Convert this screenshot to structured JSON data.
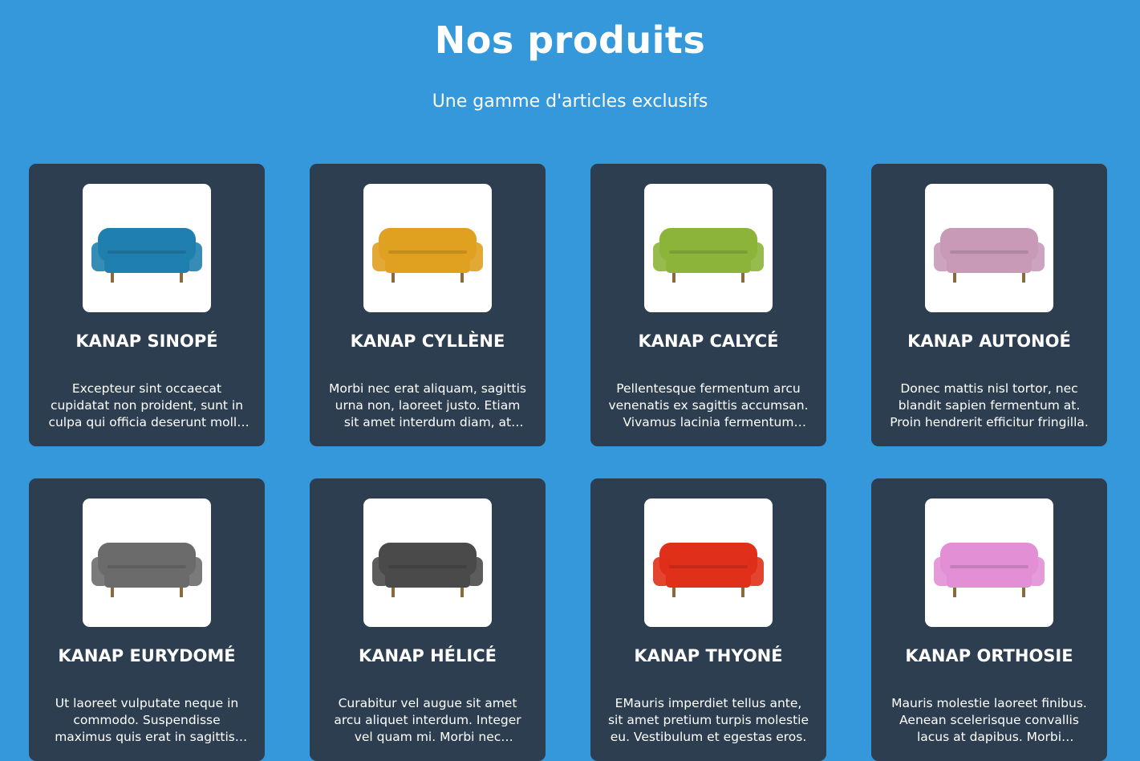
{
  "header": {
    "title": "Nos produits",
    "subtitle": "Une gamme d'articles exclusifs"
  },
  "products": [
    {
      "name": "Kanap Sinopé",
      "description": "Excepteur sint occaecat cupidatat non proident, sunt in culpa qui officia deserunt mollit anim id est laborum.",
      "color": "#1f7fae",
      "icon": "sofa-image"
    },
    {
      "name": "Kanap Cyllène",
      "description": "Morbi nec erat aliquam, sagittis urna non, laoreet justo. Etiam sit amet interdum diam, at accumsan lectus.",
      "color": "#e0a020",
      "icon": "sofa-image"
    },
    {
      "name": "Kanap Calycé",
      "description": "Pellentesque fermentum arcu venenatis ex sagittis accumsan. Vivamus lacinia fermentum tortor.",
      "color": "#8cb43a",
      "icon": "sofa-image"
    },
    {
      "name": "Kanap Autonoé",
      "description": "Donec mattis nisl tortor, nec blandit sapien fermentum at. Proin hendrerit efficitur fringilla.",
      "color": "#c89ab8",
      "icon": "sofa-image"
    },
    {
      "name": "Kanap Eurydomé",
      "description": "Ut laoreet vulputate neque in commodo. Suspendisse maximus quis erat in sagittis. Donec hendrerit purus.",
      "color": "#6b6b6b",
      "icon": "sofa-image"
    },
    {
      "name": "Kanap Hélicé",
      "description": "Curabitur vel augue sit amet arcu aliquet interdum. Integer vel quam mi. Morbi nec vehicula mi.",
      "color": "#4a4a4a",
      "icon": "sofa-image"
    },
    {
      "name": "Kanap Thyoné",
      "description": "EMauris imperdiet tellus ante, sit amet pretium turpis molestie eu. Vestibulum et egestas eros.",
      "color": "#e0301a",
      "icon": "sofa-image"
    },
    {
      "name": "Kanap orthosie",
      "description": "Mauris molestie laoreet finibus. Aenean scelerisque convallis lacus at dapibus. Morbi imperdiet enim metus.",
      "color": "#e28fd6",
      "icon": "sofa-image"
    }
  ]
}
